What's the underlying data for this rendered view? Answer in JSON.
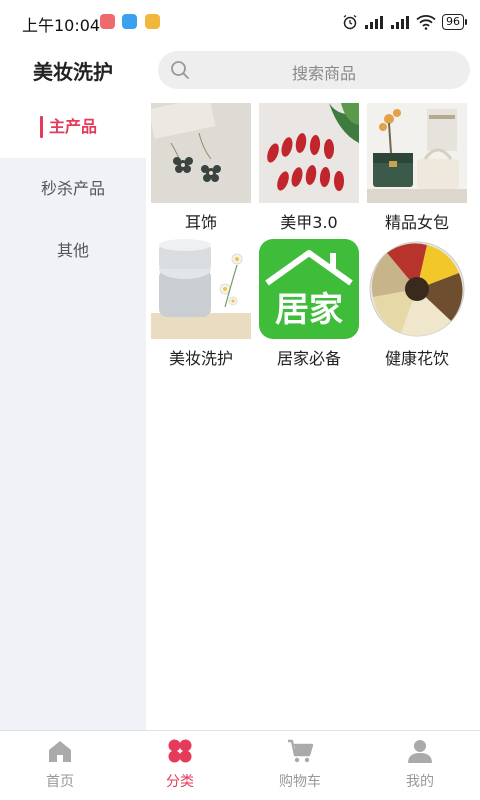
{
  "status_bar": {
    "time": "上午10:04",
    "battery": "96"
  },
  "header": {
    "title": "美妆洗护",
    "search_placeholder": "搜索商品"
  },
  "sidebar": {
    "items": [
      {
        "label": "主产品",
        "active": true
      },
      {
        "label": "秒杀产品",
        "active": false
      },
      {
        "label": "其他",
        "active": false
      }
    ]
  },
  "grid": {
    "items": [
      {
        "label": "耳饰",
        "icon": "earring-image"
      },
      {
        "label": "美甲3.0",
        "icon": "nail-image"
      },
      {
        "label": "精品女包",
        "icon": "handbag-image"
      },
      {
        "label": "美妆洗护",
        "icon": "cream-jar-image"
      },
      {
        "label": "居家必备",
        "icon": "home-logo-image",
        "logo_text": "居家"
      },
      {
        "label": "健康花饮",
        "icon": "flower-tea-image"
      }
    ]
  },
  "tabbar": {
    "tabs": [
      {
        "label": "首页",
        "icon": "home-icon",
        "active": false
      },
      {
        "label": "分类",
        "icon": "category-icon",
        "active": true
      },
      {
        "label": "购物车",
        "icon": "cart-icon",
        "active": false
      },
      {
        "label": "我的",
        "icon": "user-icon",
        "active": false
      }
    ]
  },
  "colors": {
    "accent": "#e63a5a",
    "sidebar_bg": "#f1f2f7",
    "tab_inactive": "#999999",
    "home_logo_green": "#3fbd3a"
  }
}
